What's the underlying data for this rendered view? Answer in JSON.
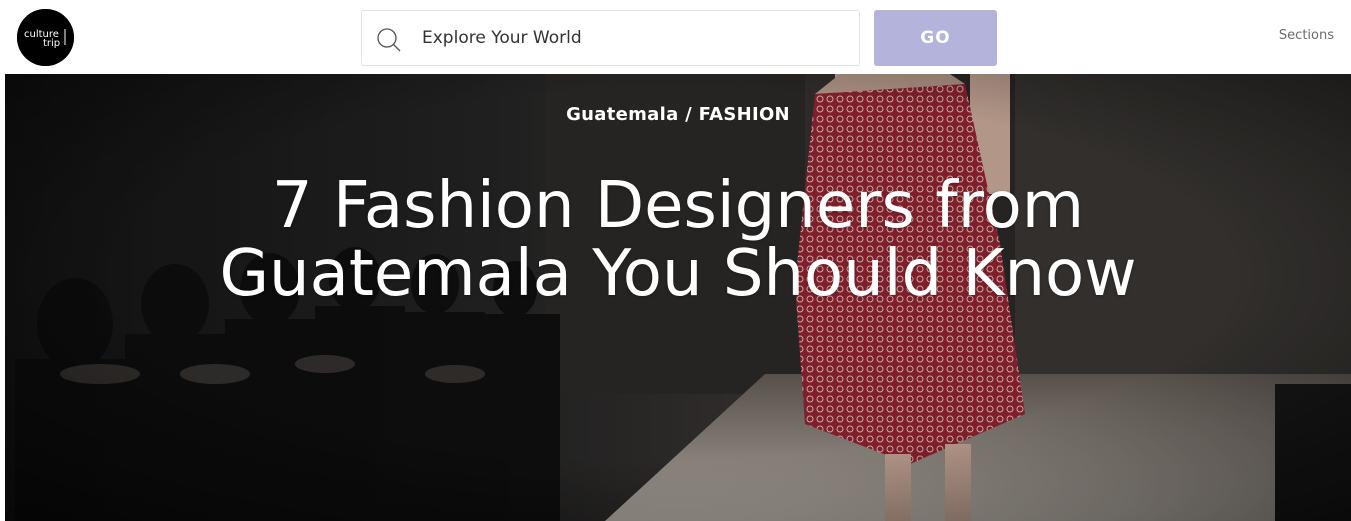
{
  "header": {
    "logo_text_line1": "culture",
    "logo_text_line2": "trip",
    "search": {
      "placeholder": "Explore Your World",
      "value": ""
    },
    "go_label": "GO",
    "sections_label": "Sections"
  },
  "hero": {
    "breadcrumb": {
      "country": "Guatemala",
      "separator": " / ",
      "category": "FASHION"
    },
    "headline": "7 Fashion Designers from Guatemala You Should Know"
  },
  "colors": {
    "go_button": "#b3b3db",
    "logo_bg": "#000000",
    "dress_red": "#a8283a"
  },
  "icons": {
    "logo": "culture-trip-logo",
    "search": "search-icon"
  }
}
